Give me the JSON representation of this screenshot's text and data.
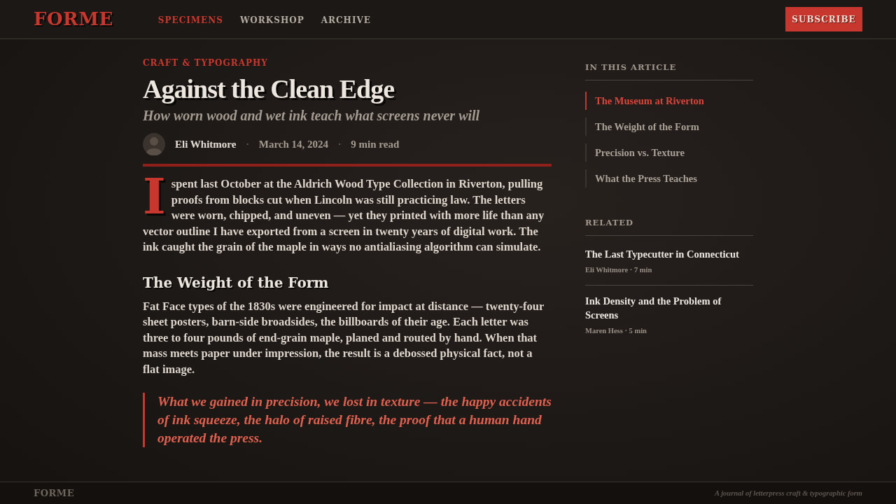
{
  "header": {
    "logo": "FORME",
    "nav": [
      {
        "label": "SPECIMENS",
        "selected": true
      },
      {
        "label": "WORKSHOP",
        "selected": false
      },
      {
        "label": "ARCHIVE",
        "selected": false
      }
    ],
    "subscribe_button": "SUBSCRIBE"
  },
  "article": {
    "category": "CRAFT & TYPOGRAPHY",
    "title": "Against the Clean Edge",
    "subtitle": "How worn wood and wet ink teach what screens never will",
    "meta": [
      {
        "kind": "author",
        "text": "Eli Whitmore"
      },
      {
        "kind": "separator",
        "text": "·"
      },
      {
        "kind": "date",
        "text": "March 14, 2024"
      },
      {
        "kind": "separator",
        "text": "·"
      },
      {
        "kind": "read_time",
        "text": "9 min read"
      }
    ],
    "body": [
      {
        "kind": "paragraph",
        "drop_cap": "I",
        "text": "spent last October at the Aldrich Wood Type Collection in Riverton, pulling proofs from blocks cut when Lincoln was still practicing law. The letters were worn, chipped, and uneven — yet they printed with more life than any vector outline I have exported from a screen in twenty years of digital work. The ink caught the grain of the maple in ways no antialiasing algorithm can simulate."
      },
      {
        "kind": "heading",
        "text": "The Weight of the Form"
      },
      {
        "kind": "paragraph",
        "text": "Fat Face types of the 1830s were engineered for impact at distance — twenty-four sheet posters, barn-side broadsides, the billboards of their age. Each letter was three to four pounds of end-grain maple, planed and routed by hand. When that mass meets paper under impression, the result is a debossed physical fact, not a flat image."
      },
      {
        "kind": "quote",
        "text": "What we gained in precision, we lost in texture — the happy accidents of ink squeeze, the halo of raised fibre, the proof that a human hand operated the press."
      }
    ]
  },
  "sidebar": {
    "toc": {
      "title": "IN THIS ARTICLE",
      "items": [
        {
          "label": "The Museum at Riverton",
          "selected": true
        },
        {
          "label": "The Weight of the Form",
          "selected": false
        },
        {
          "label": "Precision vs. Texture",
          "selected": false
        },
        {
          "label": "What the Press Teaches",
          "selected": false
        }
      ]
    },
    "related": {
      "title": "RELATED",
      "items": [
        {
          "title": "The Last Typecutter in Connecticut",
          "meta": "Eli Whitmore · 7 min"
        },
        {
          "title": "Ink Density and the Problem of Screens",
          "meta": "Maren Hess · 5 min"
        }
      ]
    }
  },
  "footer": {
    "logo": "FORME",
    "tagline": "A journal of letterpress craft & typographic form"
  }
}
